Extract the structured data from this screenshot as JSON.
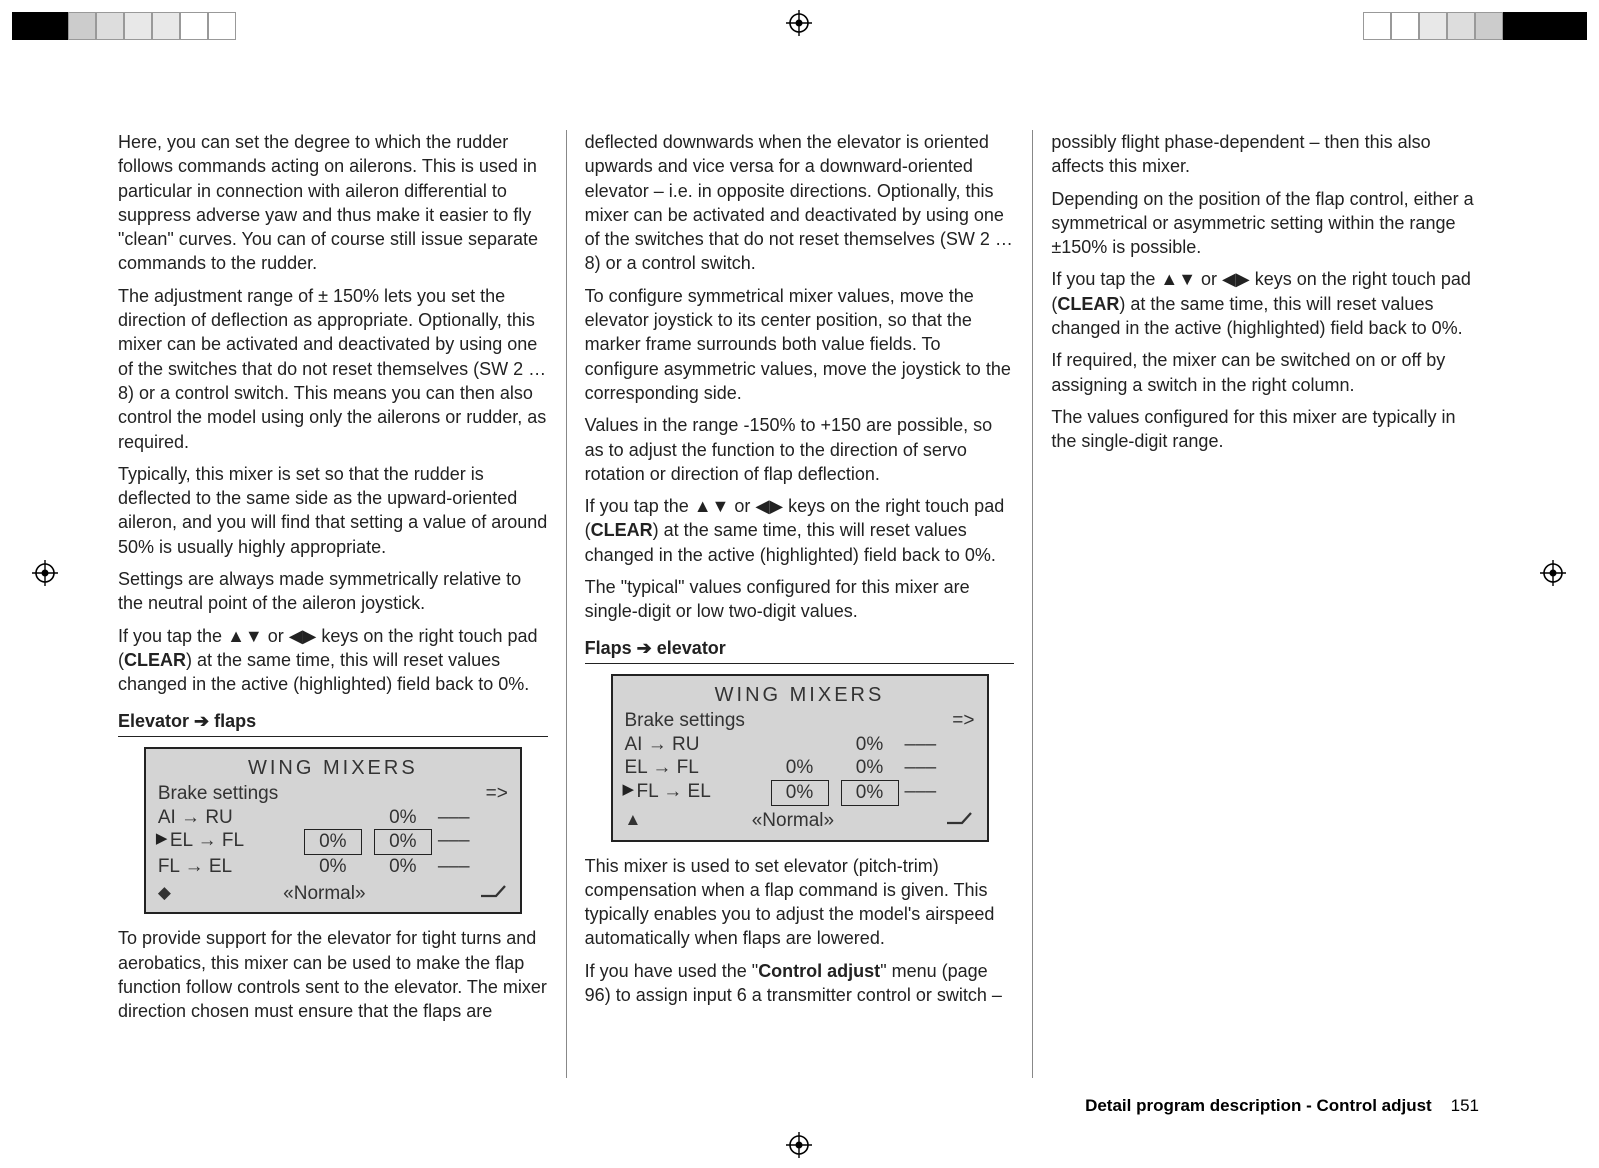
{
  "col1": {
    "p1": "Here, you can set the degree to which the rudder follows commands acting on ailerons. This is used in particular in connection with aileron differential to suppress adverse yaw and thus make it easier to fly \"clean\" curves. You can of course still issue separate commands to the rudder.",
    "p2": "The adjustment range of ± 150% lets you set the direction of deflection as appropriate. Optionally, this mixer can be activated and deactivated by using one of the switches that do not reset themselves (SW 2 … 8) or a control switch. This means you can then also control the model using only the ailerons or rudder, as required.",
    "p3": "Typically, this mixer is set so that the rudder is deflected to the same side as the upward-oriented aileron, and you will find that setting a value of around 50% is usually highly appropriate.",
    "p4": "Settings are always made symmetrically relative to the neutral point of the aileron joystick.",
    "p5a": "If you tap the ▲▼ or ◀▶ keys on the right touch pad (",
    "p5b": "CLEAR",
    "p5c": ") at the same time, this will reset values changed in the active (highlighted) field back to 0%.",
    "subhead": "Elevator ➔ flaps",
    "lcd": {
      "title": "WING  MIXERS",
      "brake": "Brake settings",
      "brake_arrow": "=>",
      "r1_c1": "AI  → RU",
      "r1_c3": "0%",
      "r1_c4": "–––",
      "r2_c1": "EL → FL",
      "r2_c2": "0%",
      "r2_c3": "0%",
      "r2_c4": "–––",
      "r3_c1": "FL  → EL",
      "r3_c2": "0%",
      "r3_c3": "0%",
      "r3_c4": "–––",
      "normal": "«Normal»"
    },
    "p6": "To provide support for the elevator for tight turns and aerobatics, this mixer can be used to make the flap function follow controls sent to the elevator. The mixer direction chosen must ensure that the flaps are"
  },
  "col2": {
    "p1": "deflected downwards when the elevator is oriented upwards and vice versa for a downward-oriented elevator – i.e. in opposite directions.  Optionally, this mixer can be activated and deactivated by using one of the switches that do not reset themselves (SW 2 … 8) or a control switch.",
    "p2": "To configure symmetrical mixer values, move the elevator joystick to its center position, so that the marker frame surrounds both value fields. To configure asymmetric values, move the joystick to the corresponding side.",
    "p3": "Values in the range -150% to +150 are possible, so as to adjust the function to the direction of servo rotation or direction of flap deflection.",
    "p4a": "If you tap the ▲▼ or ◀▶ keys on the right touch pad (",
    "p4b": "CLEAR",
    "p4c": ") at the same time, this will reset values changed in the active (highlighted) field back to 0%.",
    "p5": "The \"typical\" values configured for this mixer are single-digit or low two-digit values.",
    "subhead": "Flaps ➔ elevator",
    "lcd": {
      "title": "WING  MIXERS",
      "brake": "Brake settings",
      "brake_arrow": "=>",
      "r1_c1": "AI  → RU",
      "r1_c3": "0%",
      "r1_c4": "–––",
      "r2_c1": "EL → FL",
      "r2_c2": "0%",
      "r2_c3": "0%",
      "r2_c4": "–––",
      "r3_c1": "FL → EL",
      "r3_c2": "0%",
      "r3_c3": "0%",
      "r3_c4": "–––",
      "normal": "«Normal»"
    },
    "p6": "This mixer is used to set elevator (pitch-trim) compensation when a flap command is given. This typically enables you to adjust the model's airspeed automatically when flaps are lowered.",
    "p7a": "If you have used the \"",
    "p7b": "Control adjust",
    "p7c": "\" menu (page 96) to assign input 6 a transmitter control or switch –"
  },
  "col3": {
    "p1": "possibly flight phase-dependent – then this also affects this mixer.",
    "p2": "Depending on the position of the flap control, either a symmetrical or asymmetric setting within the range ±150% is possible.",
    "p3a": "If you tap the ▲▼ or ◀▶ keys on the right touch pad (",
    "p3b": "CLEAR",
    "p3c": ") at the same time, this will reset values changed in the active (highlighted) field back to 0%.",
    "p4": "If required, the mixer can be switched on or off by assigning a switch in the right column.",
    "p5": "The values configured for this mixer are typically in the single-digit range."
  },
  "footer": {
    "label": "Detail program description - Control adjust",
    "page": "151"
  }
}
